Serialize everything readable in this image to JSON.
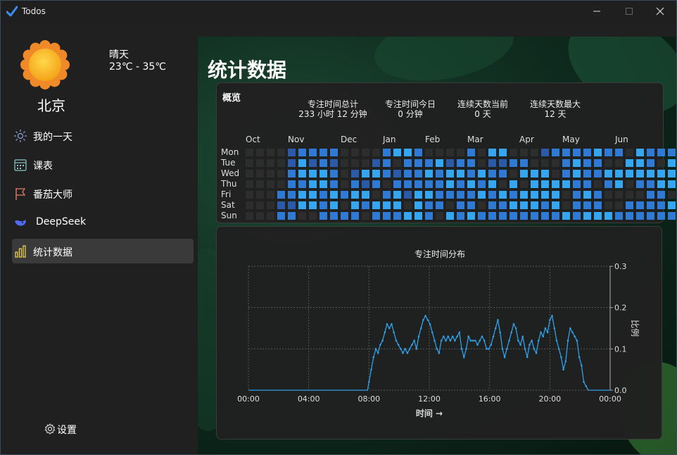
{
  "window": {
    "title": "Todos"
  },
  "sidebar": {
    "city": "北京",
    "weather_condition": "晴天",
    "temperature": "23℃ - 35℃",
    "items": [
      {
        "label": "我的一天",
        "icon": "sun-icon"
      },
      {
        "label": "课表",
        "icon": "calendar-icon"
      },
      {
        "label": "番茄大师",
        "icon": "flag-icon"
      },
      {
        "label": "DeepSeek",
        "icon": "whale-icon"
      },
      {
        "label": "统计数据",
        "icon": "bar-chart-icon",
        "active": true
      }
    ],
    "settings_label": "设置"
  },
  "main": {
    "title": "统计数据",
    "overview": {
      "title": "概览",
      "stats": [
        {
          "label": "专注时间总计",
          "value": "233 小时 12 分钟"
        },
        {
          "label": "专注时间今日",
          "value": "0 分钟"
        },
        {
          "label": "连续天数当前",
          "value": "0 天"
        },
        {
          "label": "连续天数最大",
          "value": "12 天"
        }
      ],
      "months": [
        "Oct",
        "Nov",
        "Dec",
        "Jan",
        "Feb",
        "Mar",
        "Apr",
        "May",
        "Jun"
      ],
      "days": [
        "Mon",
        "Tue",
        "Wed",
        "Thu",
        "Fri",
        "Sat",
        "Sun"
      ],
      "heatmap_levels": [
        "0000122220000233200002033000122223220322220",
        "0000131210001202223122011220002322003320332",
        "0000233320133212232332322033302322333333333",
        "0000223320212022222323230303333220230223322",
        "0002233232330231332222323233330232000022030",
        "0001133230323330322022022333230222002222320",
        "0002200222202223320323222222223233322222232"
      ],
      "level_colors": [
        "#2d2d2d",
        "#2a5aa8",
        "#2f7ad4",
        "#35a6f2"
      ]
    },
    "chart_data": {
      "type": "line",
      "title": "专注时间分布",
      "xlabel": "时间 →",
      "ylabel": "比例",
      "x_ticks": [
        "00:00",
        "04:00",
        "08:00",
        "12:00",
        "16:00",
        "20:00",
        "00:00"
      ],
      "y_ticks": [
        "0.0",
        "0.1",
        "0.2",
        "0.3"
      ],
      "xlim": [
        0,
        24
      ],
      "ylim": [
        0,
        0.3
      ],
      "grid": true,
      "color": "#2fa0e8",
      "x": [
        0,
        7.9,
        8.0,
        8.15,
        8.3,
        8.45,
        8.6,
        8.75,
        8.9,
        9.05,
        9.2,
        9.35,
        9.5,
        9.65,
        9.8,
        9.95,
        10.1,
        10.25,
        10.4,
        10.55,
        10.7,
        10.85,
        11.0,
        11.15,
        11.3,
        11.45,
        11.6,
        11.75,
        11.9,
        12.05,
        12.2,
        12.35,
        12.5,
        12.65,
        12.8,
        12.95,
        13.1,
        13.25,
        13.4,
        13.55,
        13.7,
        13.85,
        14.0,
        14.15,
        14.3,
        14.45,
        14.6,
        14.75,
        14.9,
        15.05,
        15.2,
        15.35,
        15.5,
        15.65,
        15.8,
        15.95,
        16.1,
        16.25,
        16.4,
        16.55,
        16.7,
        16.85,
        17.0,
        17.15,
        17.3,
        17.45,
        17.6,
        17.75,
        17.9,
        18.05,
        18.2,
        18.35,
        18.5,
        18.65,
        18.8,
        18.95,
        19.1,
        19.25,
        19.4,
        19.55,
        19.7,
        19.85,
        20.0,
        20.15,
        20.3,
        20.45,
        20.6,
        20.75,
        20.9,
        21.05,
        21.2,
        21.35,
        21.5,
        21.65,
        21.8,
        21.95,
        22.1,
        22.25,
        22.4,
        22.55,
        22.7,
        24
      ],
      "y": [
        0,
        0,
        0.02,
        0.05,
        0.08,
        0.1,
        0.09,
        0.11,
        0.12,
        0.14,
        0.16,
        0.15,
        0.16,
        0.14,
        0.12,
        0.11,
        0.1,
        0.09,
        0.1,
        0.09,
        0.1,
        0.11,
        0.12,
        0.1,
        0.13,
        0.15,
        0.17,
        0.18,
        0.17,
        0.16,
        0.14,
        0.12,
        0.1,
        0.09,
        0.12,
        0.13,
        0.12,
        0.13,
        0.12,
        0.13,
        0.12,
        0.13,
        0.14,
        0.1,
        0.08,
        0.1,
        0.13,
        0.12,
        0.12,
        0.12,
        0.11,
        0.12,
        0.13,
        0.12,
        0.1,
        0.1,
        0.11,
        0.13,
        0.15,
        0.17,
        0.14,
        0.1,
        0.08,
        0.1,
        0.12,
        0.14,
        0.16,
        0.15,
        0.12,
        0.11,
        0.13,
        0.1,
        0.08,
        0.11,
        0.12,
        0.1,
        0.09,
        0.12,
        0.14,
        0.13,
        0.15,
        0.14,
        0.17,
        0.18,
        0.15,
        0.12,
        0.1,
        0.08,
        0.05,
        0.07,
        0.12,
        0.15,
        0.14,
        0.13,
        0.12,
        0.08,
        0.06,
        0.02,
        0.01,
        0,
        0,
        0
      ]
    }
  }
}
